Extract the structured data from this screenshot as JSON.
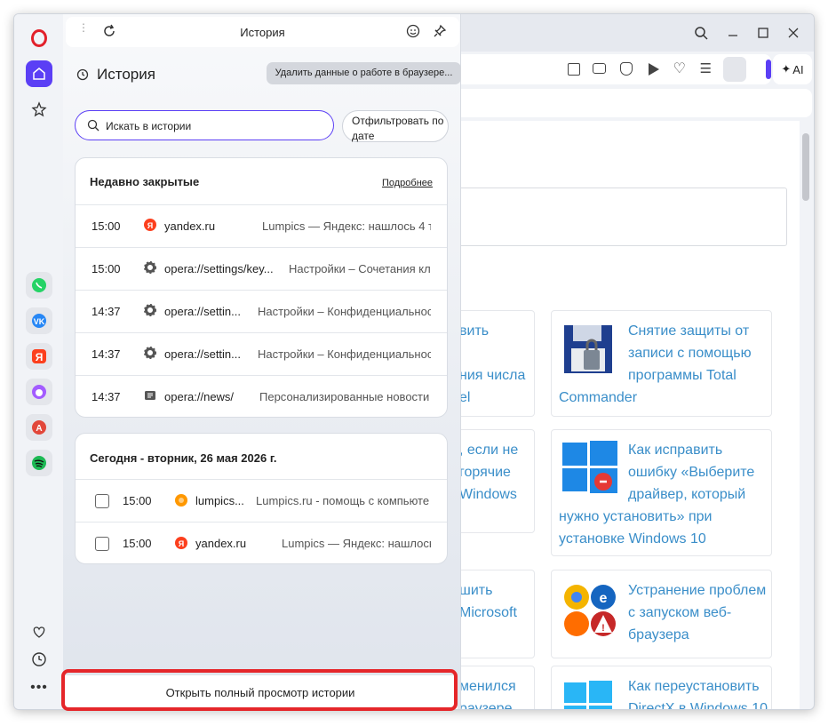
{
  "panel": {
    "header_title": "История",
    "title": "История",
    "clear_button": "Удалить данные о работе в браузере...",
    "search_placeholder": "Искать в истории",
    "filter_button": "Отфильтровать по дате",
    "recent": {
      "title": "Недавно закрытые",
      "more_link": "Подробнее",
      "items": [
        {
          "time": "15:00",
          "site": "yandex.ru",
          "desc": "Lumpics — Яндекс: нашлось 4 ты",
          "icon": "yandex-icon"
        },
        {
          "time": "15:00",
          "site": "opera://settings/key...",
          "desc": "Настройки – Сочетания кла",
          "icon": "gear-icon"
        },
        {
          "time": "14:37",
          "site": "opera://settin...",
          "desc": "Настройки – Конфиденциальнос",
          "icon": "gear-icon"
        },
        {
          "time": "14:37",
          "site": "opera://settin...",
          "desc": "Настройки – Конфиденциальнос",
          "icon": "gear-icon"
        },
        {
          "time": "14:37",
          "site": "opera://news/",
          "desc": "Персонализированные новости",
          "icon": "news-icon"
        }
      ]
    },
    "today": {
      "title": "Сегодня - вторник, 26 мая 2026 г.",
      "items": [
        {
          "time": "15:00",
          "site": "lumpics...",
          "desc": "Lumpics.ru - помощь с компьюте",
          "icon": "lumpics-icon"
        },
        {
          "time": "15:00",
          "site": "yandex.ru",
          "desc": "Lumpics — Яндекс: нашлось",
          "icon": "yandex-icon"
        }
      ]
    },
    "footer_button": "Открыть полный просмотр истории"
  },
  "ai_label": "AI",
  "cards": [
    {
      "lines": [
        "вить",
        "",
        "ния числа",
        "el"
      ]
    },
    {
      "lines": [
        "Снятие защиты от",
        "записи с помощью",
        "программы Total",
        "Commander"
      ]
    },
    {
      "lines": [
        ", если не",
        "горячие",
        "Windows"
      ]
    },
    {
      "lines": [
        "Как исправить",
        "ошибку «Выберите",
        "драйвер, который",
        "нужно установить» при",
        "установке Windows 10"
      ]
    },
    {
      "lines": [
        "шить",
        "Microsoft"
      ]
    },
    {
      "lines": [
        "Устранение проблем",
        "с запуском веб-",
        "браузера"
      ]
    },
    {
      "lines": [
        "менился",
        "раузере"
      ]
    },
    {
      "lines": [
        "Как переустановить",
        "DirectX в Windows 10"
      ]
    }
  ],
  "colors": {
    "accent": "#5b3ff5",
    "highlight": "#e5262a",
    "link": "#3a8ec9"
  }
}
